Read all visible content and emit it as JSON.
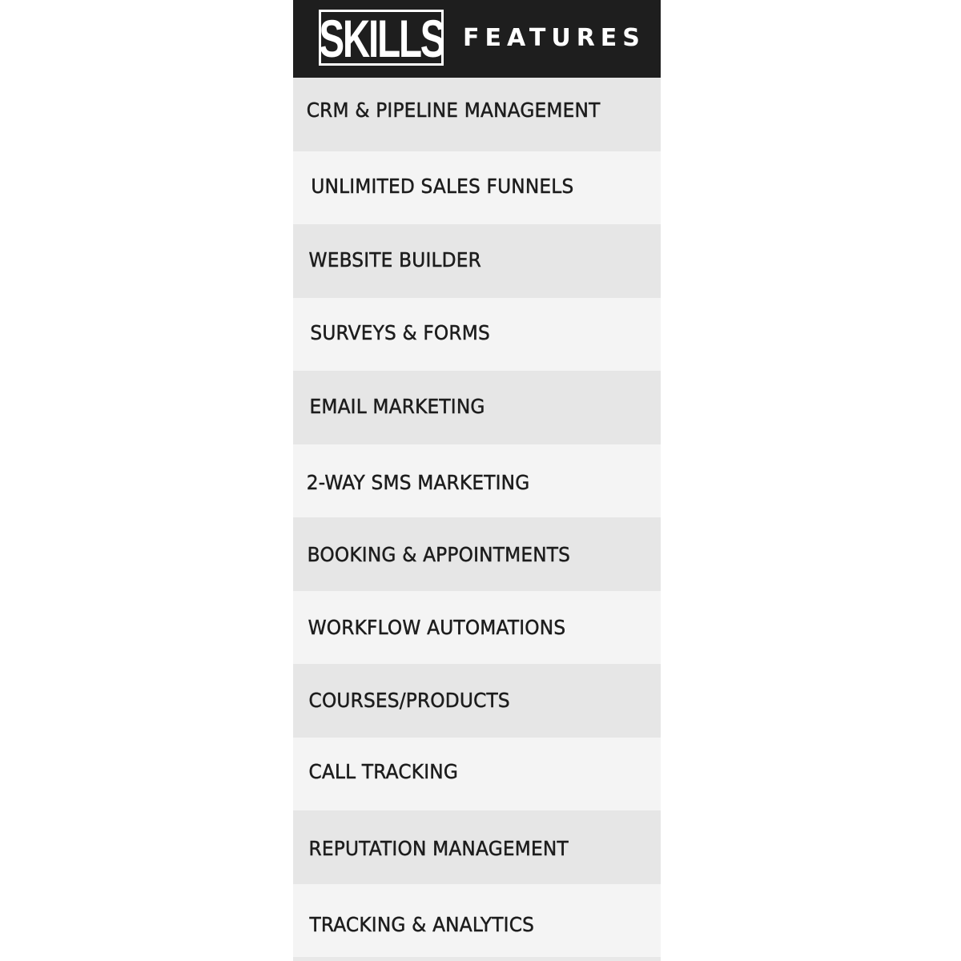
{
  "header": {
    "logo_text": "SKILLS",
    "title": "FEATURES",
    "background_color": "#1e1e1e"
  },
  "features": {
    "items": [
      {
        "label": "CRM & PIPELINE MANAGEMENT",
        "shade": "dark"
      },
      {
        "label": "UNLIMITED SALES FUNNELS",
        "shade": "light"
      },
      {
        "label": "WEBSITE BUILDER",
        "shade": "dark"
      },
      {
        "label": "SURVEYS & FORMS",
        "shade": "light"
      },
      {
        "label": "EMAIL MARKETING",
        "shade": "dark"
      },
      {
        "label": "2-WAY SMS MARKETING",
        "shade": "light"
      },
      {
        "label": "BOOKING & APPOINTMENTS",
        "shade": "dark"
      },
      {
        "label": "WORKFLOW AUTOMATIONS",
        "shade": "light"
      },
      {
        "label": "COURSES/PRODUCTS",
        "shade": "dark"
      },
      {
        "label": "CALL TRACKING",
        "shade": "light"
      },
      {
        "label": "REPUTATION MANAGEMENT",
        "shade": "dark"
      },
      {
        "label": "TRACKING & ANALYTICS",
        "shade": "light"
      }
    ],
    "colors": {
      "dark_row": "#e6e6e6",
      "light_row": "#f4f4f4",
      "text": "#1d1d1d"
    }
  }
}
